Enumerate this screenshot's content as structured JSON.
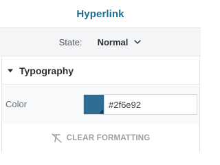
{
  "header": {
    "title": "Hyperlink"
  },
  "state": {
    "label": "State:",
    "value": "Normal"
  },
  "typography": {
    "title": "Typography",
    "color": {
      "label": "Color",
      "hex": "#2f6e92",
      "swatch_color": "#2f6e92"
    },
    "clear_formatting": "CLEAR FORMATTING"
  },
  "icons": {
    "state_dropdown": "chevron-down-icon",
    "section_toggle": "caret-down-icon",
    "clear_formatting": "clear-format-icon"
  },
  "colors": {
    "accent": "#1f6d94",
    "panel_bg": "#f4f5f6",
    "muted_text": "#9aa0a5"
  }
}
